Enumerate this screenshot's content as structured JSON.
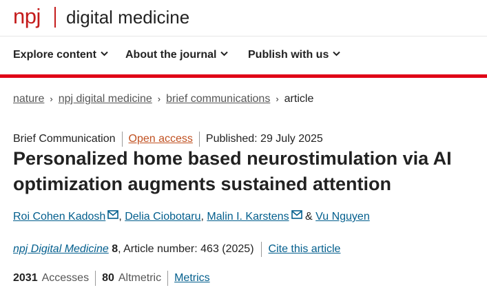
{
  "site": {
    "brand_short": "npj",
    "brand_name": "digital medicine",
    "accent_color": "#e00016"
  },
  "nav": {
    "items": [
      {
        "label": "Explore content"
      },
      {
        "label": "About the journal"
      },
      {
        "label": "Publish with us"
      }
    ]
  },
  "breadcrumb": {
    "items": [
      {
        "label": "nature"
      },
      {
        "label": "npj digital medicine"
      },
      {
        "label": "brief communications"
      },
      {
        "label": "article"
      }
    ],
    "separator": "›"
  },
  "article": {
    "type": "Brief Communication",
    "access": "Open access",
    "published": "Published: 29 July 2025",
    "title": "Personalized home based neurostimulation via AI optimization augments sustained attention",
    "authors": [
      {
        "name": "Roi Cohen Kadosh",
        "has_email": true
      },
      {
        "name": "Delia Ciobotaru",
        "has_email": false
      },
      {
        "name": "Malin I. Karstens",
        "has_email": true
      },
      {
        "name": "Vu Nguyen",
        "has_email": false
      }
    ],
    "author_sep_comma": ",",
    "author_sep_amp": "&",
    "journal": "npj Digital Medicine",
    "volume": "8",
    "article_number": ", Article number: 463 (2025)",
    "cite_label": "Cite this article"
  },
  "metrics": {
    "accesses_value": "2031",
    "accesses_label": "Accesses",
    "altmetric_value": "80",
    "altmetric_label": "Altmetric",
    "metrics_link": "Metrics"
  }
}
